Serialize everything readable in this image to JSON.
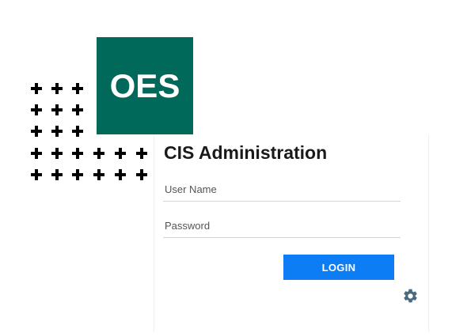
{
  "logo": {
    "text": "OES",
    "color": "#01695a"
  },
  "login": {
    "title": "CIS Administration",
    "username_placeholder": "User Name",
    "username_value": "",
    "password_placeholder": "Password",
    "password_value": "",
    "button_label": "LOGIN",
    "button_color": "#0d7df5"
  },
  "icons": {
    "decoration": "plus-pattern",
    "settings": "gear-icon",
    "settings_color": "#4a6a80"
  }
}
